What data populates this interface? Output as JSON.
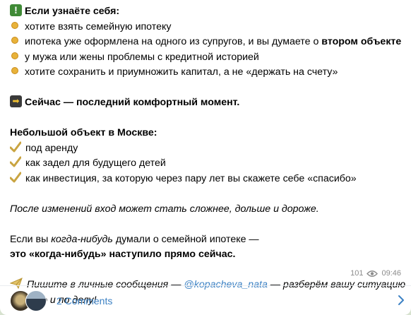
{
  "post": {
    "intro_heading": "Если узнаёте себя:",
    "bullets": [
      "хотите взять семейную ипотеку",
      {
        "text": "ипотека уже оформлена на одного из супругов, и вы думаете о ",
        "bold": "втором объекте"
      },
      "у мужа или жены проблемы с кредитной историей",
      "хотите сохранить и приумножить капитал, а не «держать на счету»"
    ],
    "now_line": "Сейчас — последний комфортный момент.",
    "small_object_heading": "Небольшой объект в Москве:",
    "checks": [
      "под аренду",
      "как задел для будущего детей",
      "как инвестиция, за которую через пару лет вы скажете себе «спасибо»"
    ],
    "italic_note": "После изменений вход может стать сложнее, дольше и дороже.",
    "if_line": {
      "a": "Если вы ",
      "b_italic": "когда-нибудь",
      "c": " думали о семейной ипотеке —"
    },
    "bold_line": "это «когда-нибудь» наступило прямо сейчас.",
    "cta": {
      "before": "Пишите в личные сообщения — ",
      "link": "@kopacheva_nata",
      "after": " — разберём вашу ситуацию",
      "line2": "быстро и по делу!"
    },
    "views": "101",
    "time": "09:46"
  },
  "comments": {
    "label": "2 Comments"
  },
  "colors": {
    "link": "#3d82c4",
    "meta": "#8c8c8c",
    "excl_bg": "#3f8a36"
  },
  "icons": [
    "exclamation-icon",
    "bullet-dot-icon",
    "arrow-right-icon",
    "check-icon",
    "paper-plane-icon",
    "eye-icon",
    "chevron-right-icon"
  ]
}
